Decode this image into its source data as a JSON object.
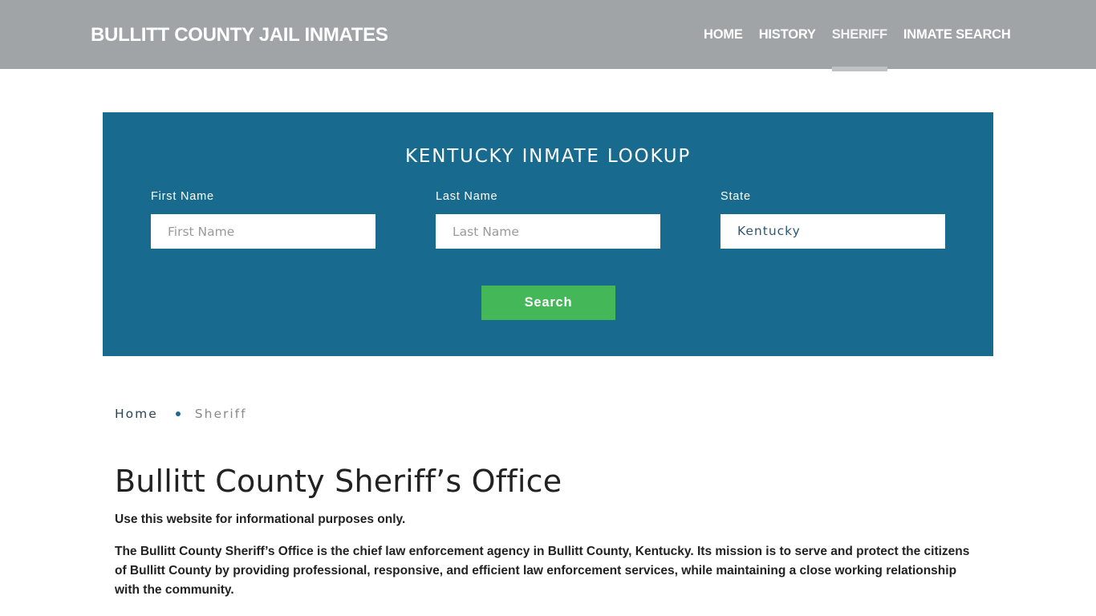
{
  "header": {
    "brand": "BULLITT COUNTY JAIL INMATES",
    "nav": [
      {
        "label": "HOME",
        "active": false
      },
      {
        "label": "HISTORY",
        "active": false
      },
      {
        "label": "SHERIFF",
        "active": true
      },
      {
        "label": "INMATE SEARCH",
        "active": false
      }
    ]
  },
  "lookup": {
    "title": "KENTUCKY INMATE LOOKUP",
    "first_name": {
      "label": "First Name",
      "placeholder": "First Name",
      "value": ""
    },
    "last_name": {
      "label": "Last Name",
      "placeholder": "Last Name",
      "value": ""
    },
    "state": {
      "label": "State",
      "value": "Kentucky"
    },
    "search_label": "Search"
  },
  "breadcrumb": {
    "home": "Home",
    "current": "Sheriff"
  },
  "main": {
    "title": "Bullitt County Sheriff’s Office",
    "paragraphs": [
      "Use this website for informational purposes only.",
      "The Bullitt County Sheriff’s Office is the chief law enforcement agency in Bullitt County, Kentucky. Its mission is to serve and protect the citizens of Bullitt County by providing professional, responsive, and efficient law enforcement services, while maintaining a close working relationship with the community."
    ]
  },
  "colors": {
    "header_bg": "#a0a4a7",
    "lookup_bg": "#186b8e",
    "search_button": "#44b758",
    "active_underline": "#bfc2c4"
  }
}
